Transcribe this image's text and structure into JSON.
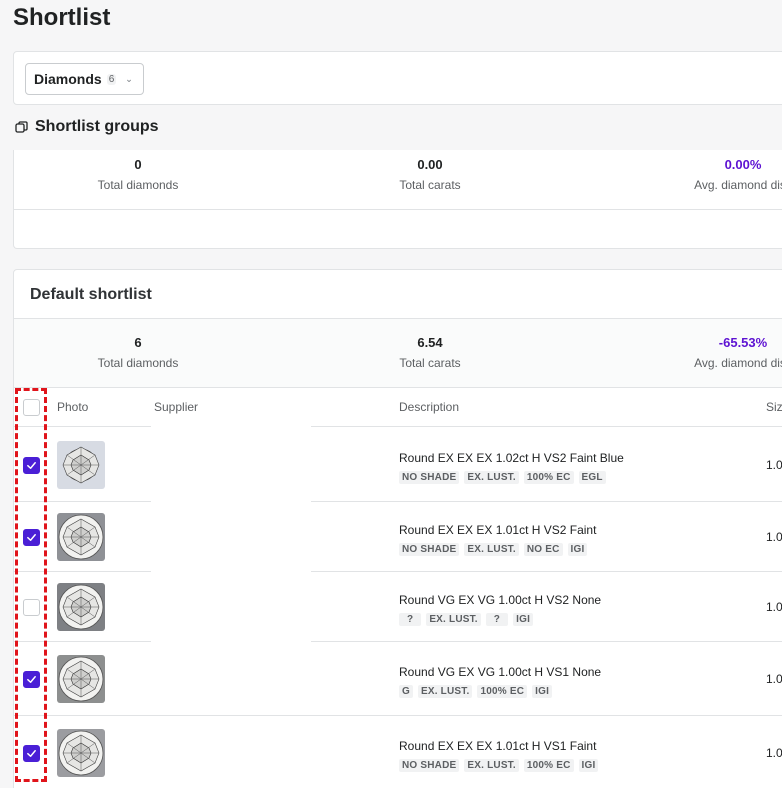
{
  "page": {
    "title": "Shortlist"
  },
  "tabs": {
    "active_label": "Diamonds",
    "active_count": "6"
  },
  "groups": {
    "heading": "Shortlist groups",
    "stats": [
      {
        "value": "0",
        "label": "Total diamonds"
      },
      {
        "value": "0.00",
        "label": "Total carats"
      },
      {
        "value": "0.00%",
        "label": "Avg. diamond disc"
      }
    ]
  },
  "default_shortlist": {
    "title": "Default shortlist",
    "stats": [
      {
        "value": "6",
        "label": "Total diamonds"
      },
      {
        "value": "6.54",
        "label": "Total carats"
      },
      {
        "value": "-65.53%",
        "label": "Avg. diamond disc"
      }
    ],
    "columns": {
      "photo": "Photo",
      "supplier": "Supplier",
      "description": "Description",
      "size": "Siz"
    },
    "rows": [
      {
        "checked": true,
        "description": "Round EX EX EX 1.02ct H VS2 Faint Blue",
        "tags": [
          "NO SHADE",
          "EX. LUST.",
          "100% EC",
          "EGL"
        ],
        "size": "1.0"
      },
      {
        "checked": true,
        "description": "Round EX EX EX 1.01ct H VS2 Faint",
        "tags": [
          "NO SHADE",
          "EX. LUST.",
          "NO EC",
          "IGI"
        ],
        "size": "1.0"
      },
      {
        "checked": false,
        "description": "Round VG EX VG 1.00ct H VS2 None",
        "tags": [
          "?",
          "EX. LUST.",
          "?",
          "IGI"
        ],
        "size": "1.0"
      },
      {
        "checked": true,
        "description": "Round VG EX VG 1.00ct H VS1 None",
        "tags": [
          "G",
          "EX. LUST.",
          "100% EC",
          "IGI"
        ],
        "size": "1.0"
      },
      {
        "checked": true,
        "description": "Round EX EX EX 1.01ct H VS1 Faint",
        "tags": [
          "NO SHADE",
          "EX. LUST.",
          "100% EC",
          "IGI"
        ],
        "size": "1.0"
      }
    ]
  },
  "colors": {
    "accent": "#4a1fd6",
    "discount": "#5d12d2",
    "highlight": "#e0141b"
  },
  "icons": {
    "groups_heading": "stack-icon",
    "checkbox_check": "check-icon",
    "dropdown": "chevron-down-icon"
  }
}
